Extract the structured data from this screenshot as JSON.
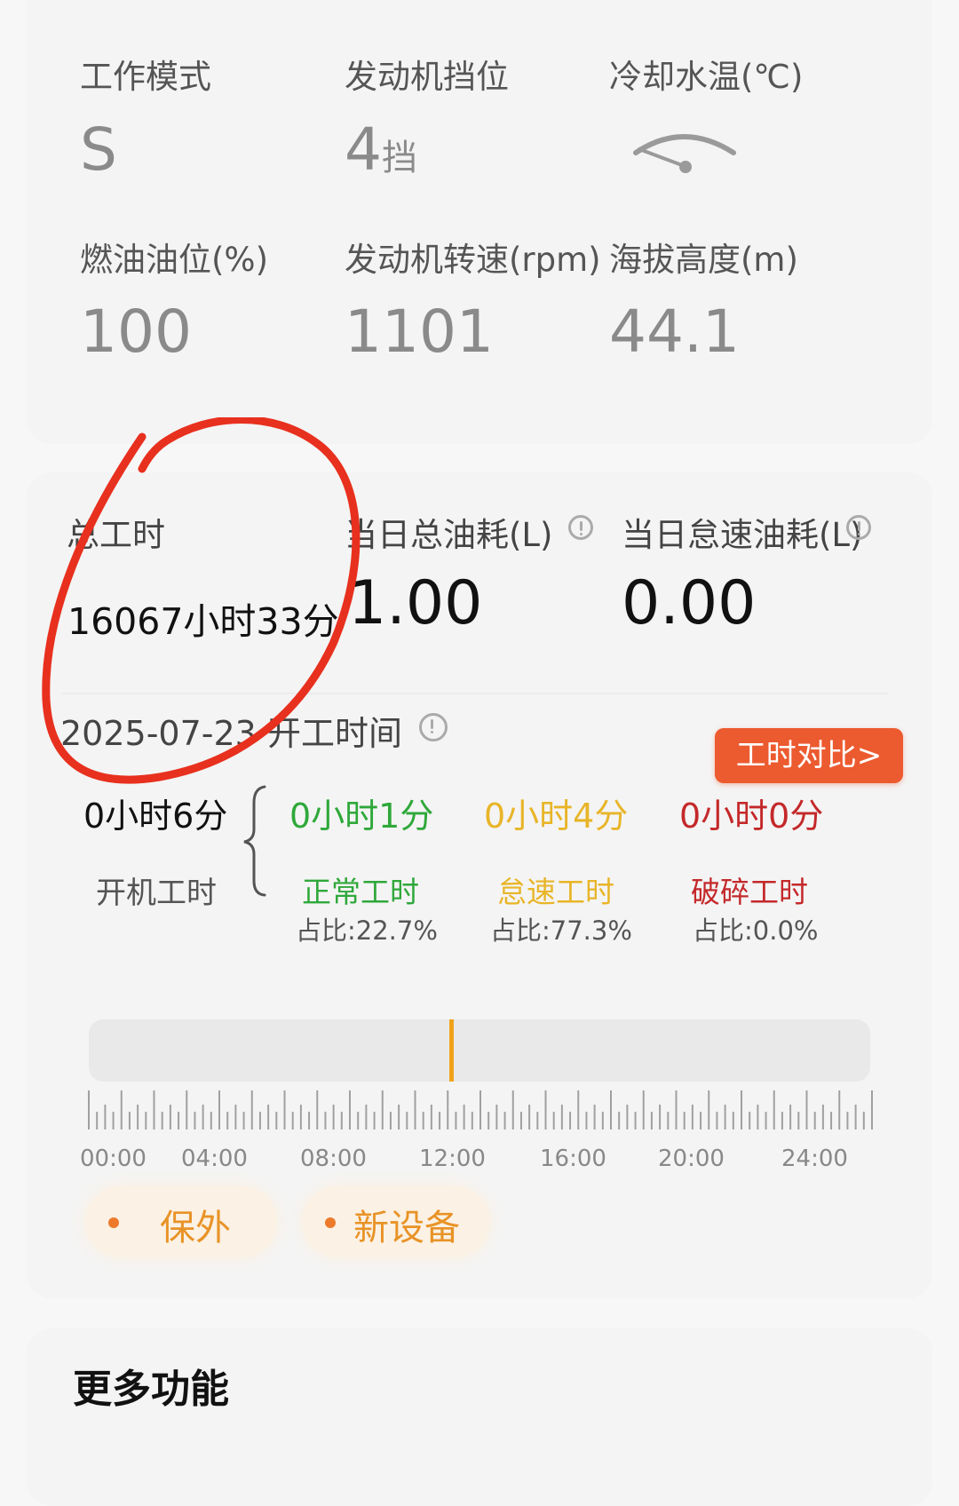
{
  "status": {
    "items": [
      {
        "label": "工作模式",
        "value": "S"
      },
      {
        "label": "发动机挡位",
        "value": "4",
        "unit": "挡"
      },
      {
        "label": "冷却水温(℃)",
        "value": ""
      },
      {
        "label": "燃油油位(%)",
        "value": "100"
      },
      {
        "label": "发动机转速(rpm)",
        "value": "1101"
      },
      {
        "label": "海拔高度(m)",
        "value": "44.1"
      }
    ]
  },
  "summary": {
    "total_hours_label": "总工时",
    "total_hours_value": "16067小时33分",
    "fuel_label": "当日总油耗(L)",
    "fuel_value": "1.00",
    "idle_fuel_label": "当日怠速油耗(L)",
    "idle_fuel_value": "0.00"
  },
  "worktime": {
    "date": "2025-07-23",
    "title": "开工时间",
    "compare_button": "工时对比>",
    "on_time_value": "0小时6分",
    "on_time_label": "开机工时",
    "categories": [
      {
        "value": "0小时1分",
        "label": "正常工时",
        "ratio": "占比:22.7%",
        "color": "#2fa83a"
      },
      {
        "value": "0小时4分",
        "label": "怠速工时",
        "ratio": "占比:77.3%",
        "color": "#e8b528"
      },
      {
        "value": "0小时0分",
        "label": "破碎工时",
        "ratio": "占比:0.0%",
        "color": "#c4282a"
      }
    ],
    "timeline_labels": [
      "00:00",
      "04:00",
      "08:00",
      "12:00",
      "16:00",
      "20:00",
      "24:00"
    ],
    "marker_color": "#f0a31a"
  },
  "tags": [
    "保外",
    "新设备"
  ],
  "more": {
    "title": "更多功能"
  },
  "annotation_color": "#e8301e"
}
